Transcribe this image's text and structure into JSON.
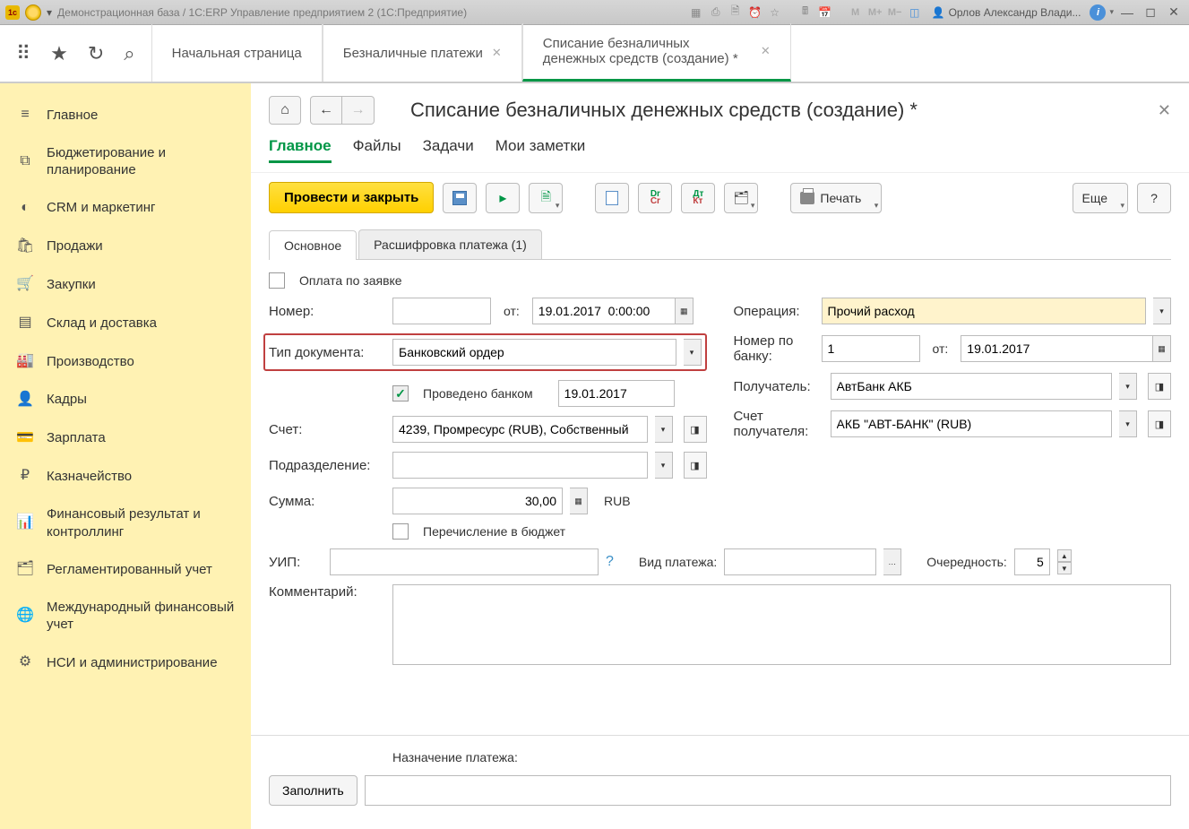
{
  "titlebar": {
    "title": "Демонстрационная база / 1С:ERP Управление предприятием 2  (1С:Предприятие)",
    "user": "Орлов Александр Влади..."
  },
  "toptabs": [
    {
      "label": "Начальная страница",
      "closable": false
    },
    {
      "label": "Безналичные платежи",
      "closable": true
    },
    {
      "label": "Списание безналичных денежных средств (создание) *",
      "closable": true
    }
  ],
  "sidebar": [
    {
      "icon": "≡",
      "label": "Главное"
    },
    {
      "icon": "⧉",
      "label": "Бюджетирование и планирование"
    },
    {
      "icon": "◐",
      "label": "CRM и маркетинг"
    },
    {
      "icon": "🛍",
      "label": "Продажи"
    },
    {
      "icon": "🛒",
      "label": "Закупки"
    },
    {
      "icon": "▤",
      "label": "Склад и доставка"
    },
    {
      "icon": "🏭",
      "label": "Производство"
    },
    {
      "icon": "👤",
      "label": "Кадры"
    },
    {
      "icon": "💳",
      "label": "Зарплата"
    },
    {
      "icon": "₽",
      "label": "Казначейство"
    },
    {
      "icon": "📊",
      "label": "Финансовый результат и контроллинг"
    },
    {
      "icon": "🗂",
      "label": "Регламентированный учет"
    },
    {
      "icon": "🌐",
      "label": "Международный финансовый учет"
    },
    {
      "icon": "⚙",
      "label": "НСИ и администрирование"
    }
  ],
  "doc": {
    "title": "Списание безналичных денежных средств (создание) *",
    "tabs": [
      "Главное",
      "Файлы",
      "Задачи",
      "Мои заметки"
    ],
    "toolbar": {
      "primary": "Провести и закрыть",
      "print": "Печать",
      "more": "Еще"
    },
    "inner_tabs": [
      "Основное",
      "Расшифровка платежа (1)"
    ],
    "labels": {
      "pay_by_request": "Оплата по заявке",
      "number": "Номер:",
      "from": "от:",
      "operation": "Операция:",
      "doc_type": "Тип документа:",
      "bank_number": "Номер по банку:",
      "from2": "от:",
      "bank_done": "Проведено банком",
      "recipient": "Получатель:",
      "account": "Счет:",
      "recipient_account": "Счет получателя:",
      "department": "Подразделение:",
      "sum": "Сумма:",
      "currency": "RUB",
      "budget_transfer": "Перечисление в бюджет",
      "uip": "УИП:",
      "payment_type": "Вид платежа:",
      "priority": "Очередность:",
      "comment": "Комментарий:",
      "purpose": "Назначение платежа:",
      "fill": "Заполнить"
    },
    "values": {
      "number": "",
      "date": "19.01.2017  0:00:00",
      "operation": "Прочий расход",
      "doc_type": "Банковский ордер",
      "bank_number": "1",
      "bank_date": "19.01.2017",
      "bank_done_date": "19.01.2017",
      "recipient": "АвтБанк АКБ",
      "account": "4239, Промресурс (RUB), Собственный",
      "recipient_account": "АКБ \"АВТ-БАНК\" (RUB)",
      "department": "",
      "sum": "30,00",
      "uip": "",
      "payment_type": "",
      "priority": "5",
      "comment": "",
      "purpose": ""
    }
  }
}
